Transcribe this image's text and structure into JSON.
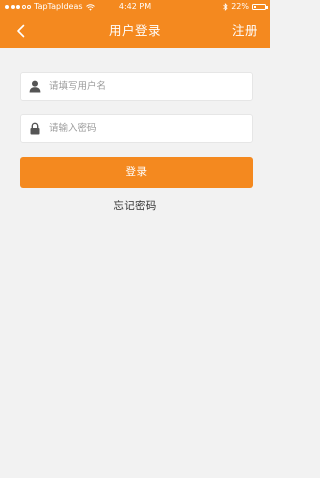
{
  "status_bar": {
    "carrier": "TapTapIdeas",
    "time": "4:42 PM",
    "battery_percent": "22%",
    "battery_level": 0.22,
    "signal_bars": 3
  },
  "nav": {
    "back_icon": "chevron-left-icon",
    "title": "用户登录",
    "register_label": "注册"
  },
  "form": {
    "username": {
      "icon": "user-icon",
      "placeholder": "请填写用户名",
      "value": ""
    },
    "password": {
      "icon": "lock-icon",
      "placeholder": "请输入密码",
      "value": ""
    },
    "login_label": "登录",
    "forgot_label": "忘记密码"
  },
  "colors": {
    "accent": "#f4891f",
    "background": "#f2f2f2",
    "field_background": "#ffffff",
    "text": "#333333",
    "placeholder": "#9a9a9a"
  }
}
